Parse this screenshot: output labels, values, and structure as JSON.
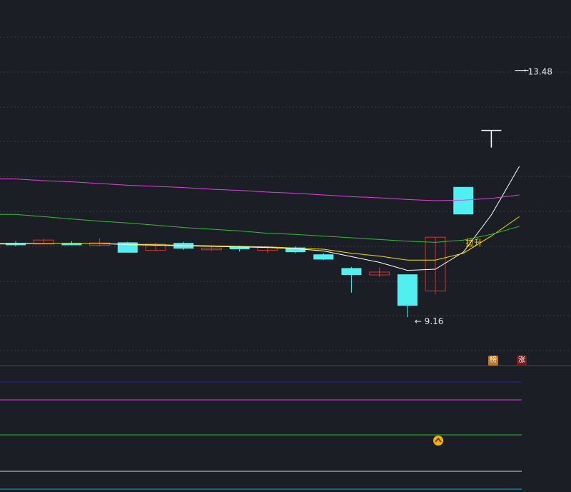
{
  "chart_data": {
    "type": "candlestick",
    "ylim": [
      8.0,
      14.0
    ],
    "grid": true,
    "candles": [
      {
        "o": 10.46,
        "h": 10.49,
        "l": 10.4,
        "c": 10.42
      },
      {
        "o": 10.44,
        "h": 10.53,
        "l": 10.44,
        "c": 10.51
      },
      {
        "o": 10.46,
        "h": 10.49,
        "l": 10.42,
        "c": 10.42
      },
      {
        "o": 10.42,
        "h": 10.54,
        "l": 10.4,
        "c": 10.46
      },
      {
        "o": 10.47,
        "h": 10.48,
        "l": 10.29,
        "c": 10.29
      },
      {
        "o": 10.33,
        "h": 10.46,
        "l": 10.33,
        "c": 10.44
      },
      {
        "o": 10.46,
        "h": 10.48,
        "l": 10.34,
        "c": 10.36
      },
      {
        "o": 10.34,
        "h": 10.4,
        "l": 10.32,
        "c": 10.37
      },
      {
        "o": 10.39,
        "h": 10.41,
        "l": 10.31,
        "c": 10.35
      },
      {
        "o": 10.33,
        "h": 10.4,
        "l": 10.29,
        "c": 10.38
      },
      {
        "o": 10.38,
        "h": 10.4,
        "l": 10.28,
        "c": 10.3
      },
      {
        "o": 10.26,
        "h": 10.28,
        "l": 10.16,
        "c": 10.17
      },
      {
        "o": 10.02,
        "h": 10.04,
        "l": 9.59,
        "c": 9.9
      },
      {
        "o": 9.9,
        "h": 10.03,
        "l": 9.86,
        "c": 9.95
      },
      {
        "o": 9.91,
        "h": 9.91,
        "l": 9.16,
        "c": 9.36
      },
      {
        "o": 9.62,
        "h": 10.56,
        "l": 9.56,
        "c": 10.56
      },
      {
        "o": 11.44,
        "h": 11.44,
        "l": 10.96,
        "c": 10.96
      },
      {
        "o": 12.43,
        "h": 12.43,
        "l": 12.18,
        "c": 12.43
      },
      {
        "o": 13.48,
        "h": 13.48,
        "l": 13.48,
        "c": 13.48
      }
    ],
    "ma_lines": [
      {
        "color": "#ffffff",
        "values": [
          10.45,
          10.45,
          10.45,
          10.45,
          10.43,
          10.42,
          10.41,
          10.4,
          10.39,
          10.38,
          10.36,
          10.32,
          10.22,
          10.12,
          9.98,
          10.0,
          10.3,
          10.95,
          11.8
        ]
      },
      {
        "color": "#f0e000",
        "values": [
          10.44,
          10.45,
          10.45,
          10.45,
          10.44,
          10.43,
          10.42,
          10.41,
          10.4,
          10.39,
          10.37,
          10.35,
          10.28,
          10.23,
          10.16,
          10.16,
          10.28,
          10.58,
          10.92
        ]
      },
      {
        "color": "#2fbf2f",
        "values": [
          10.96,
          10.92,
          10.88,
          10.84,
          10.81,
          10.77,
          10.73,
          10.7,
          10.67,
          10.63,
          10.61,
          10.58,
          10.55,
          10.52,
          10.49,
          10.47,
          10.51,
          10.61,
          10.75
        ]
      },
      {
        "color": "#e040e0",
        "values": [
          11.58,
          11.55,
          11.53,
          11.5,
          11.47,
          11.45,
          11.43,
          11.4,
          11.38,
          11.35,
          11.33,
          11.3,
          11.27,
          11.25,
          11.22,
          11.2,
          11.21,
          11.24,
          11.3
        ]
      }
    ],
    "annotations": {
      "low_label": "9.16",
      "high_label": "13.48",
      "signal_text": "拉升"
    },
    "indicator_lines": [
      {
        "color": "#1a2aa8"
      },
      {
        "color": "#e040e0"
      },
      {
        "color": "#2fbf2f"
      },
      {
        "color": "#d8d8d8"
      },
      {
        "color": "#2aa0d0"
      }
    ],
    "colors": {
      "up": "#e03030",
      "down": "#50f0f0",
      "background": "#1b1e25",
      "grid": "#3a3f4a"
    }
  },
  "badges": {
    "bang": "榜",
    "zhang": "涨"
  },
  "bottom_marker": {
    "icon": "chevron-up-icon",
    "color": "#f5b400"
  }
}
